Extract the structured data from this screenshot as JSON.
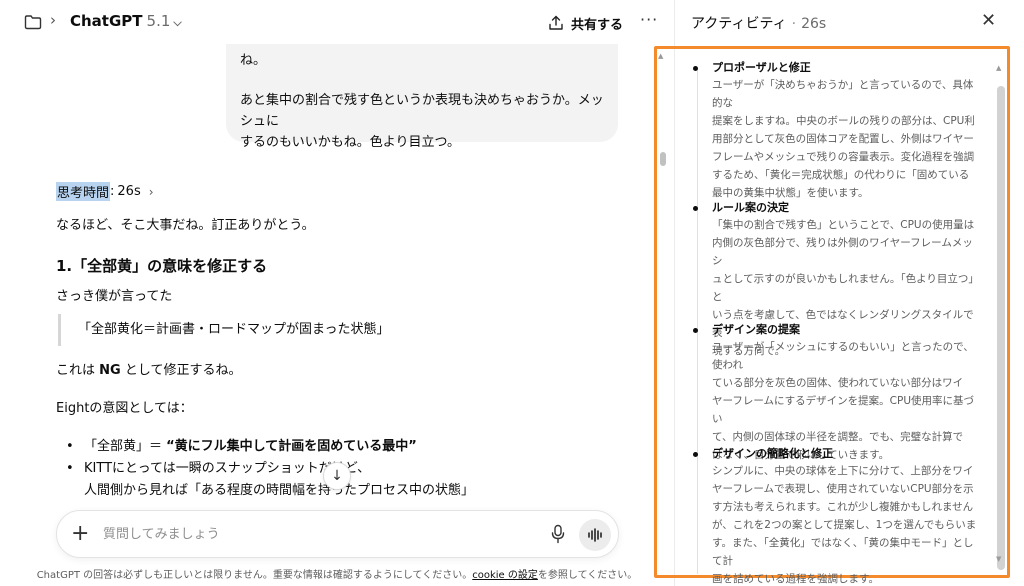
{
  "header": {
    "model_name": "ChatGPT",
    "model_version": "5.1",
    "share_label": "共有する",
    "more_label": "···"
  },
  "user_message": {
    "line1": "ね。",
    "line2": "あと集中の割合で残す色というか表現も決めちゃおうか。メッシュに",
    "line3": "するのもいいかもね。色より目立つ。"
  },
  "thinking": {
    "label": "思考時間",
    "time": "26s"
  },
  "answer": {
    "p1": "なるほど、そこ大事だね。訂正ありがとう。",
    "h1": "1.「全部黄」の意味を修正する",
    "p2": "さっき僕が言ってた",
    "quote": "「全部黄化＝計画書・ロードマップが固まった状態」",
    "p3_a": "これは ",
    "p3_b": "NG",
    "p3_c": " として修正するね。",
    "p4": "Eightの意図としては：",
    "li1_a": "「全部黄」＝ ",
    "li1_b": "“黄にフル集中して計画を固めている最中”",
    "li2": "KITTにとっては一瞬のスナップショットだけど、",
    "li2_cont": "人間側から見れば「ある程度の時間幅を持ったプロセス中の状態」"
  },
  "composer": {
    "placeholder": "質問してみましょう",
    "value": ""
  },
  "disclaimer": {
    "text_before": "ChatGPT の回答は必ずしも正しいとは限りません。重要な情報は確認するようにしてください。",
    "link": "cookie の設定",
    "text_after": "を参照してください。"
  },
  "activity": {
    "title": "アクティビティ",
    "time": "26s",
    "items": [
      {
        "title": "プロポーザルと修正",
        "lines": [
          "ユーザーが「決めちゃおうか」と言っているので、具体的な",
          "提案をしますね。中央のボールの残りの部分は、CPU利",
          "用部分として灰色の固体コアを配置し、外側はワイヤー",
          "フレームやメッシュで残りの容量表示。変化過程を強調",
          "するため、「黄化＝完成状態」の代わりに「固めている",
          "最中の黄集中状態」を使います。"
        ]
      },
      {
        "title": "ルール案の決定",
        "lines": [
          "「集中の割合で残す色」ということで、CPUの使用量は",
          "内側の灰色部分で、残りは外側のワイヤーフレームメッシ",
          "ュとして示すのが良いかもしれません。「色より目立つ」と",
          "いう点を考慮して、色ではなくレンダリングスタイルで表",
          "現する方向で。"
        ]
      },
      {
        "title": "デザイン案の提案",
        "lines": [
          "ユーザーが「メッシュにするのもいい」と言ったので、使われ",
          "ている部分を灰色の固体、使われていない部分はワイ",
          "ヤーフレームにするデザインを提案。CPU使用率に基づい",
          "て、内側の固体球の半径を調整。でも、完璧な計算で",
          "はなく、目分量で形にしていきます。"
        ]
      },
      {
        "title": "デザインの簡略化と修正",
        "lines": [
          "シンプルに、中央の球体を上下に分けて、上部分をワイ",
          "ヤーフレームで表現し、使用されていないCPU部分を示",
          "す方法も考えられます。これが少し複雑かもしれません",
          "が、これを2つの案として提案し、1つを選んでもらいま",
          "す。また、「全黄化」ではなく、「黄の集中モード」として計",
          "画を詰めている過程を強調します。"
        ]
      }
    ]
  },
  "colors": {
    "highlight": "#b7d3f0",
    "frame": "#f48a2c",
    "bubble": "#f3f3f3"
  }
}
